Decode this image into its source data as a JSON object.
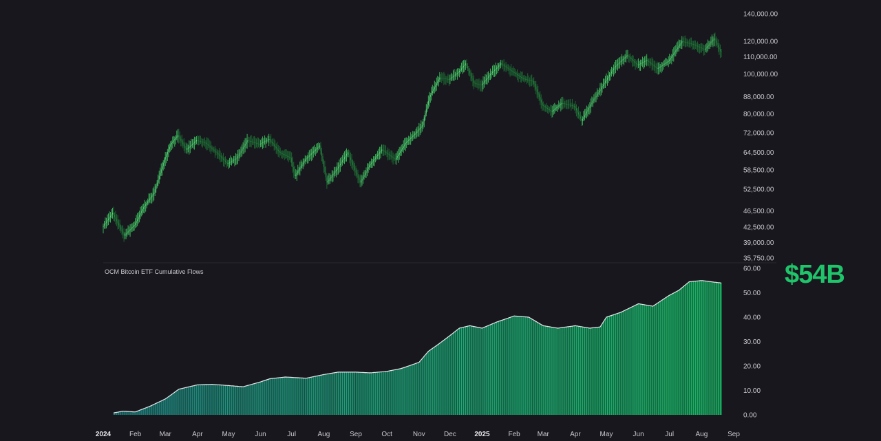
{
  "colors": {
    "background": "#18171d",
    "price_candle": "#2fa84f",
    "flow_bar_start": "#1f8a86",
    "flow_bar_end": "#19c46a",
    "flow_outline": "#e8e8ec",
    "highlight": "#1fc46b"
  },
  "highlight_value": "$54B",
  "chart_data": [
    {
      "type": "line",
      "title": "",
      "scale": "log",
      "ylim": [
        35750,
        140000
      ],
      "y_ticks": [
        "140,000.00",
        "120,000.00",
        "110,000.00",
        "100,000.00",
        "88,000.00",
        "80,000.00",
        "72,000.00",
        "64,500.00",
        "58,500.00",
        "52,500.00",
        "46,500.00",
        "42,500.00",
        "39,000.00",
        "35,750.00"
      ],
      "x_labels": [
        "2024",
        "Feb",
        "Mar",
        "Apr",
        "May",
        "Jun",
        "Jul",
        "Aug",
        "Sep",
        "Oct",
        "Nov",
        "Dec",
        "2025",
        "Feb",
        "Mar",
        "Apr",
        "May",
        "Jun",
        "Jul",
        "Aug",
        "Sep"
      ],
      "series": [
        {
          "x": [
            "2024-01-01",
            "2024-01-11",
            "2024-01-22",
            "2024-02-01",
            "2024-02-10",
            "2024-02-20",
            "2024-03-01",
            "2024-03-07",
            "2024-03-14",
            "2024-03-22",
            "2024-04-01",
            "2024-04-10",
            "2024-04-20",
            "2024-05-01",
            "2024-05-10",
            "2024-05-20",
            "2024-06-01",
            "2024-06-10",
            "2024-06-20",
            "2024-07-01",
            "2024-07-05",
            "2024-07-15",
            "2024-07-29",
            "2024-08-05",
            "2024-08-15",
            "2024-08-25",
            "2024-09-06",
            "2024-09-15",
            "2024-09-27",
            "2024-10-10",
            "2024-10-20",
            "2024-10-30",
            "2024-11-05",
            "2024-11-12",
            "2024-11-22",
            "2024-12-01",
            "2024-12-10",
            "2024-12-17",
            "2024-12-25",
            "2025-01-01",
            "2025-01-10",
            "2025-01-20",
            "2025-02-01",
            "2025-02-10",
            "2025-02-20",
            "2025-03-01",
            "2025-03-10",
            "2025-03-20",
            "2025-04-01",
            "2025-04-08",
            "2025-04-20",
            "2025-05-01",
            "2025-05-10",
            "2025-05-22",
            "2025-06-01",
            "2025-06-10",
            "2025-06-20",
            "2025-07-01",
            "2025-07-14",
            "2025-07-25",
            "2025-08-05",
            "2025-08-14",
            "2025-08-20"
          ],
          "values": [
            42500,
            46000,
            40500,
            43000,
            47500,
            51500,
            62000,
            67500,
            71000,
            65500,
            69000,
            68000,
            64500,
            60500,
            62500,
            69000,
            67500,
            69500,
            64500,
            62500,
            56500,
            62000,
            67000,
            54500,
            59000,
            64500,
            54500,
            60000,
            65500,
            62000,
            68000,
            72000,
            75000,
            88000,
            98000,
            97000,
            101000,
            106000,
            95000,
            94000,
            100000,
            106000,
            101000,
            97500,
            96000,
            84000,
            81000,
            85000,
            83500,
            77000,
            87000,
            96000,
            104000,
            111000,
            105000,
            108000,
            103000,
            107500,
            120000,
            118000,
            114500,
            122000,
            113500
          ]
        }
      ]
    },
    {
      "type": "area",
      "title": "OCM Bitcoin ETF Cumulative Flows",
      "ylim": [
        0,
        60
      ],
      "y_ticks": [
        "60.00",
        "50.00",
        "40.00",
        "30.00",
        "20.00",
        "10.00",
        "0.00"
      ],
      "series": [
        {
          "x": [
            "2024-01-11",
            "2024-01-20",
            "2024-02-01",
            "2024-02-15",
            "2024-03-01",
            "2024-03-14",
            "2024-04-01",
            "2024-04-15",
            "2024-05-01",
            "2024-05-15",
            "2024-06-01",
            "2024-06-10",
            "2024-06-25",
            "2024-07-15",
            "2024-08-01",
            "2024-08-15",
            "2024-09-01",
            "2024-09-15",
            "2024-10-01",
            "2024-10-15",
            "2024-11-01",
            "2024-11-10",
            "2024-11-20",
            "2024-12-01",
            "2024-12-10",
            "2024-12-20",
            "2025-01-01",
            "2025-01-15",
            "2025-02-01",
            "2025-02-15",
            "2025-03-01",
            "2025-03-15",
            "2025-04-01",
            "2025-04-15",
            "2025-04-25",
            "2025-05-01",
            "2025-05-15",
            "2025-06-01",
            "2025-06-15",
            "2025-07-01",
            "2025-07-10",
            "2025-07-20",
            "2025-08-01",
            "2025-08-10",
            "2025-08-20"
          ],
          "values": [
            0.8,
            1.5,
            1.2,
            3.5,
            6.5,
            10.5,
            12.3,
            12.5,
            12.0,
            11.5,
            13.5,
            14.8,
            15.5,
            15.0,
            16.5,
            17.5,
            17.5,
            17.2,
            17.8,
            19.0,
            21.5,
            26.0,
            29.0,
            32.5,
            35.5,
            36.5,
            35.5,
            38.0,
            40.5,
            40.0,
            36.5,
            35.5,
            36.5,
            35.5,
            36.0,
            40.0,
            42.0,
            45.5,
            44.5,
            49.0,
            51.0,
            54.5,
            55.0,
            54.5,
            54.0
          ]
        }
      ]
    }
  ]
}
